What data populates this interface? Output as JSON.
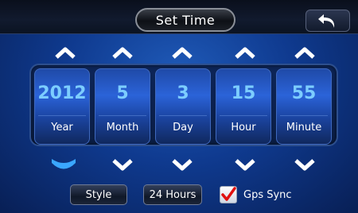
{
  "header": {
    "title": "Set Time"
  },
  "columns": [
    {
      "key": "year",
      "value": "2012",
      "label": "Year"
    },
    {
      "key": "month",
      "value": "5",
      "label": "Month"
    },
    {
      "key": "day",
      "value": "3",
      "label": "Day"
    },
    {
      "key": "hour",
      "value": "15",
      "label": "Hour"
    },
    {
      "key": "minute",
      "value": "55",
      "label": "Minute"
    }
  ],
  "buttons": {
    "style_label": "Style",
    "hours_label": "24 Hours"
  },
  "gps": {
    "label": "Gps Sync",
    "checked": true
  },
  "colors": {
    "accent": "#7ccdff",
    "selected_arrow": "#3aa7ff",
    "check": "#e01010"
  },
  "icons": {
    "back": "back-arrow-icon",
    "up": "chevron-up-icon",
    "down": "chevron-down-icon"
  }
}
